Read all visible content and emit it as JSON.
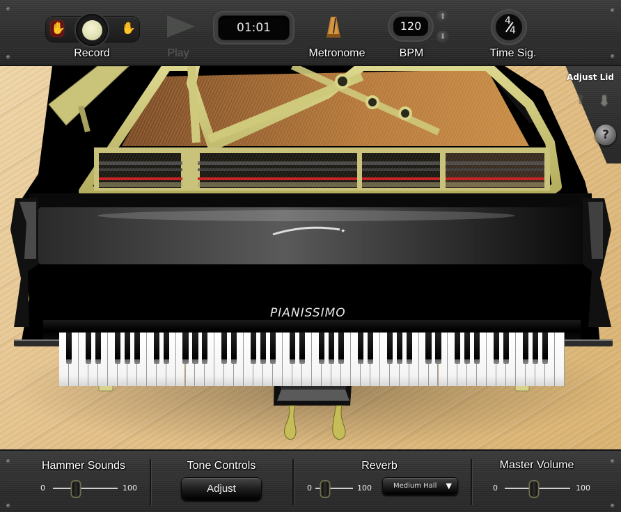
{
  "toolbar": {
    "record": {
      "label": "Record",
      "state": "off",
      "left_icon": "hand-stop-icon",
      "right_icon": "hand-icon"
    },
    "play": {
      "label": "Play",
      "enabled": false,
      "icon": "play-icon"
    },
    "time_display": "01:01",
    "metronome": {
      "label": "Metronome",
      "icon": "metronome-icon"
    },
    "bpm": {
      "label": "BPM",
      "value": "120",
      "up_icon": "arrow-up-icon",
      "down_icon": "arrow-down-icon"
    },
    "time_signature": {
      "label": "Time Sig.",
      "numerator": "4",
      "denominator": "4"
    }
  },
  "lid_panel": {
    "label": "Adjust Lid",
    "up_icon": "arrow-up-icon",
    "down_icon": "arrow-down-icon",
    "help_label": "?"
  },
  "piano": {
    "brand": "PIANISSIMO",
    "white_keys": 52,
    "black_key_pattern": "A0 A#0 B0 then C D E F G A B octaves to C8"
  },
  "bottom": {
    "hammer_sounds": {
      "label": "Hammer Sounds",
      "min": "0",
      "max": "100",
      "value": 35
    },
    "tone_controls": {
      "label": "Tone Controls",
      "button": "Adjust"
    },
    "reverb": {
      "label": "Reverb",
      "min": "0",
      "max": "100",
      "value": 25,
      "preset": "Medium Hall",
      "caret": "▼"
    },
    "master_volume": {
      "label": "Master Volume",
      "min": "0",
      "max": "100",
      "value": 45
    }
  },
  "colors": {
    "panel": "#2e2e2e",
    "floor": "#e2c08a",
    "frame_plate": "#c9c47a",
    "piano_body": "#050505",
    "record_light": "#e8e8c0"
  }
}
